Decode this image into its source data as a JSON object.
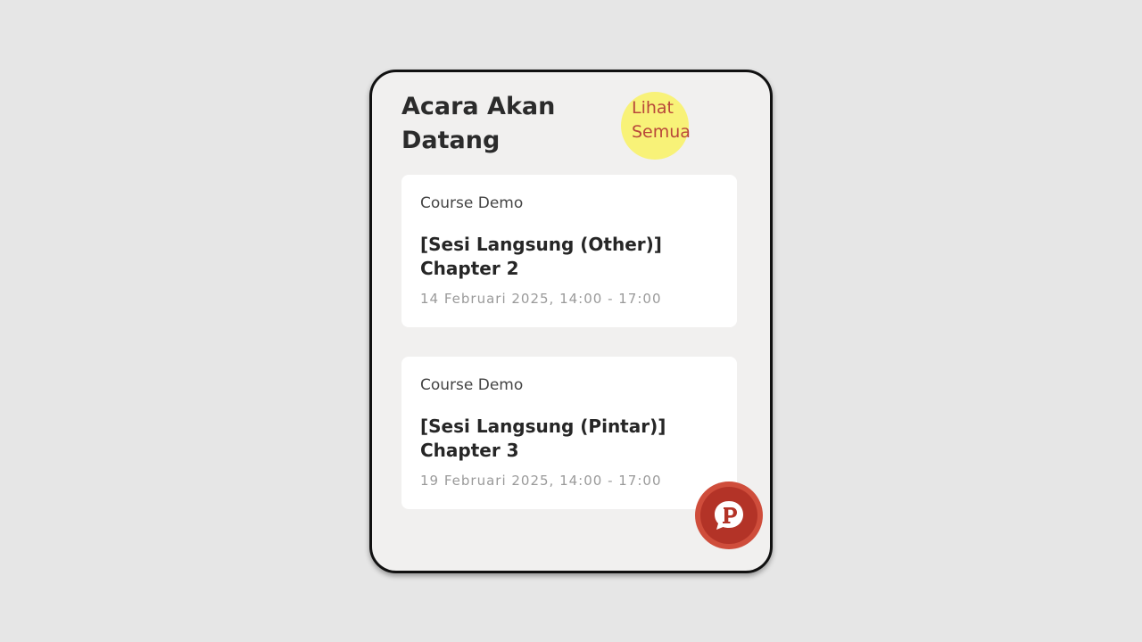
{
  "section": {
    "title": "Acara Akan Datang",
    "see_all_label": "Lihat Semua"
  },
  "events": [
    {
      "course": "Course Demo",
      "title": "[Sesi Langsung (Other)] Chapter 2",
      "datetime": "14 Februari 2025, 14:00 - 17:00"
    },
    {
      "course": "Course Demo",
      "title": "[Sesi Langsung (Pintar)] Chapter 3",
      "datetime": "19 Februari 2025, 14:00 - 17:00"
    }
  ],
  "fab": {
    "icon": "chat-p-logo-icon"
  },
  "colors": {
    "background": "#e6e6e6",
    "panel": "#f1f0ef",
    "card": "#ffffff",
    "link": "#b8473a",
    "highlight": "#f8f278",
    "fab": "#cf4d3b"
  }
}
